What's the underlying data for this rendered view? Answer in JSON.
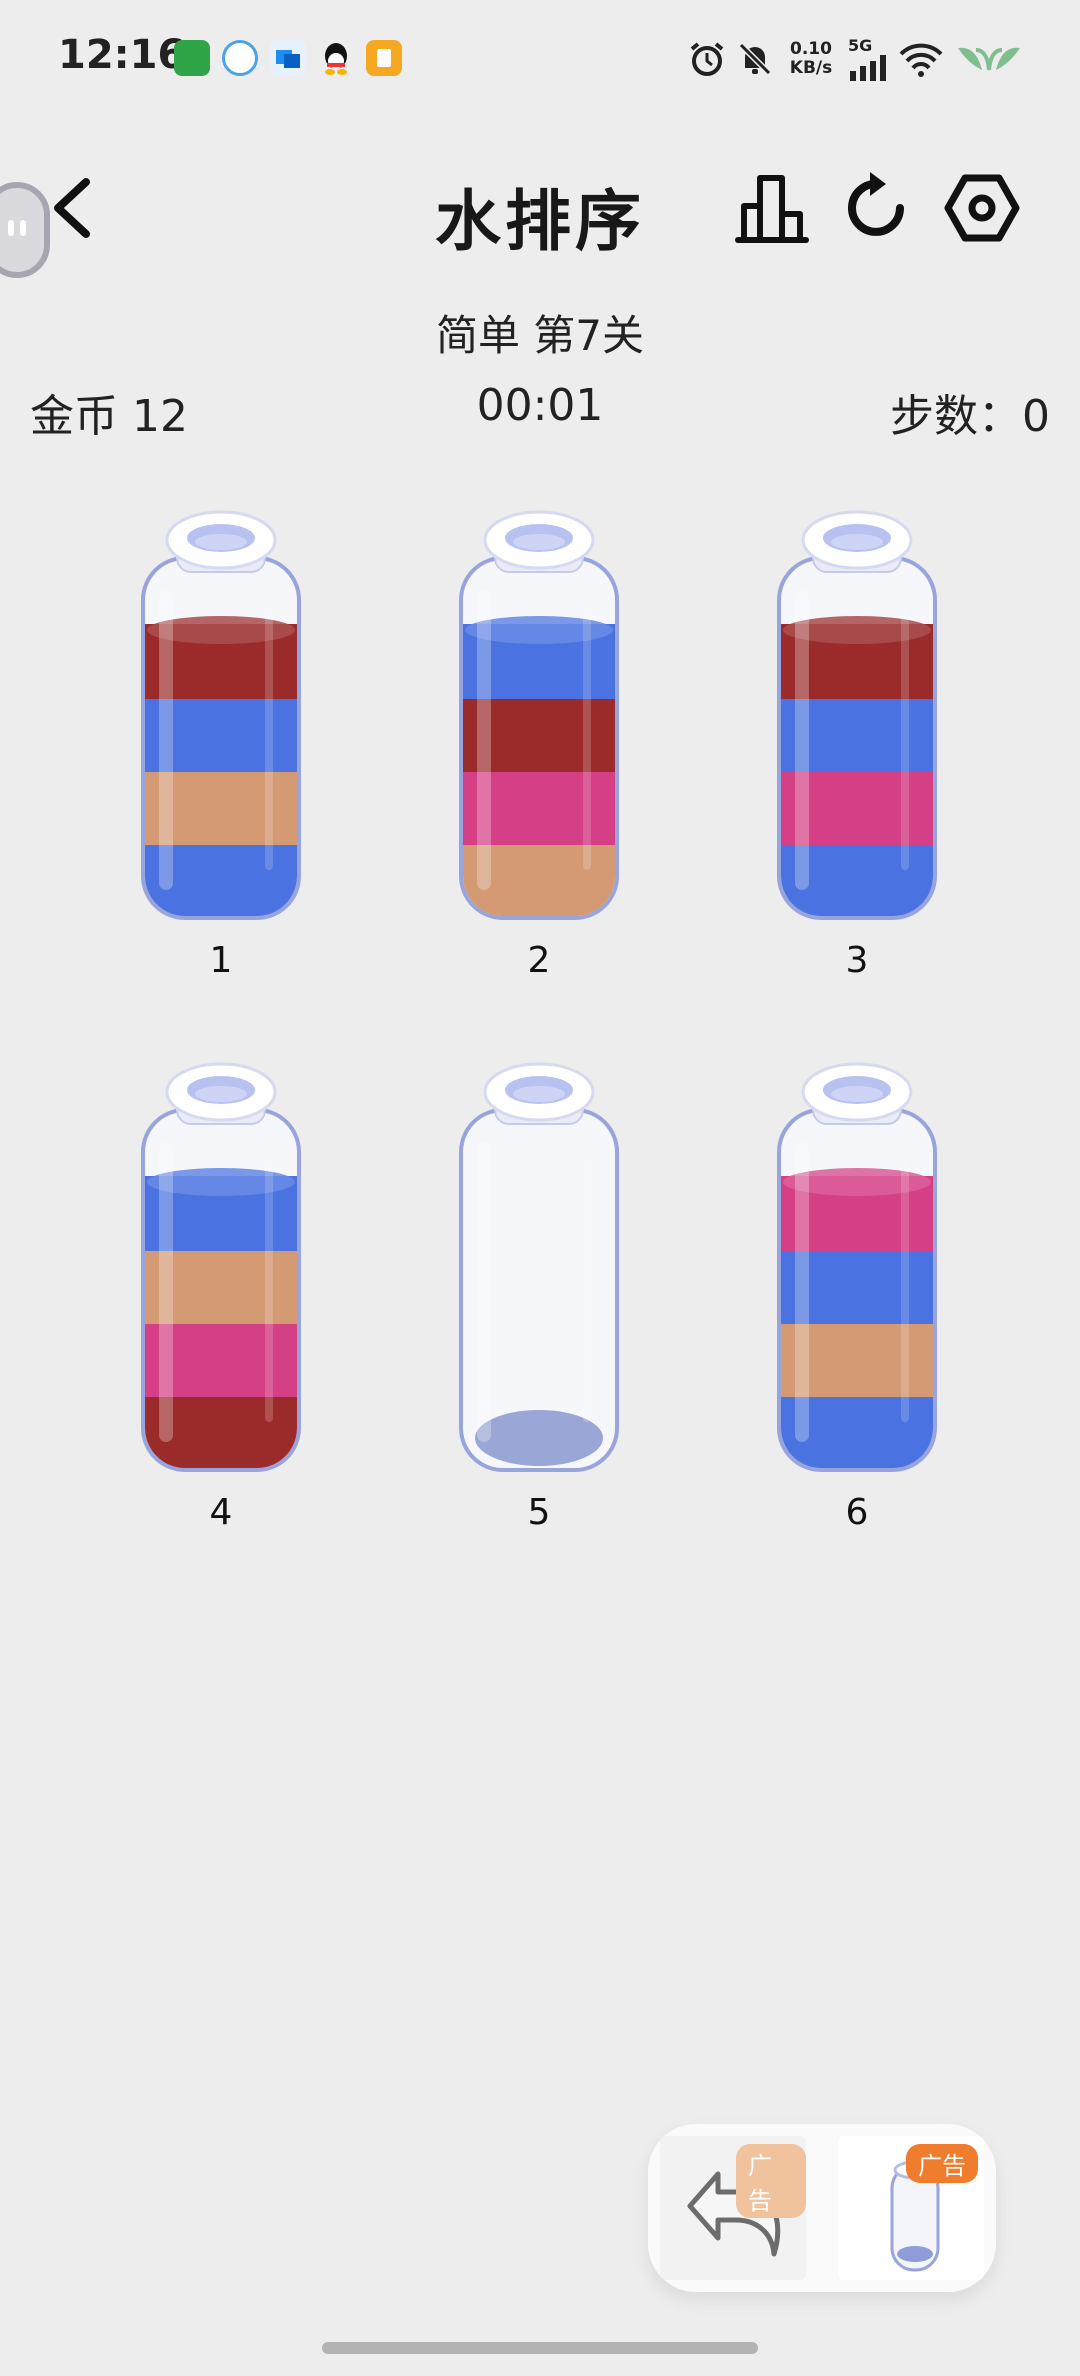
{
  "status_bar": {
    "time": "12:16",
    "net_speed_value": "0.10",
    "net_speed_unit": "KB/s",
    "network_gen": "5G",
    "notif_icons": [
      "app-green-icon",
      "chat-bubble-icon",
      "blue-app-icon",
      "qq-icon",
      "yellow-app-icon"
    ],
    "sys_icons": [
      "alarm-icon",
      "mute-icon",
      "signal-icon",
      "wifi-icon",
      "battery-icon"
    ]
  },
  "header": {
    "title": "水排序",
    "icons": [
      "back-icon",
      "leaderboard-icon",
      "restart-icon",
      "settings-icon"
    ]
  },
  "level": {
    "subtitle": "简单 第7关",
    "coins": "金币 12",
    "timer": "00:01",
    "steps": "步数：0"
  },
  "colors": {
    "red": "#9b2b2b",
    "blue": "#4a72e0",
    "tan": "#d39a74",
    "pink": "#d43f86",
    "glass_rim": "#98a4dc"
  },
  "bottles": [
    {
      "label": "1",
      "layers_bottom_to_top": [
        "blue",
        "tan",
        "blue",
        "red"
      ]
    },
    {
      "label": "2",
      "layers_bottom_to_top": [
        "tan",
        "pink",
        "red",
        "blue"
      ]
    },
    {
      "label": "3",
      "layers_bottom_to_top": [
        "blue",
        "pink",
        "blue",
        "red"
      ]
    },
    {
      "label": "4",
      "layers_bottom_to_top": [
        "red",
        "pink",
        "tan",
        "blue"
      ]
    },
    {
      "label": "5",
      "layers_bottom_to_top": []
    },
    {
      "label": "6",
      "layers_bottom_to_top": [
        "blue",
        "tan",
        "blue",
        "pink"
      ]
    }
  ],
  "tools": {
    "undo_badge": "广告",
    "add_bottle_badge": "广告"
  }
}
